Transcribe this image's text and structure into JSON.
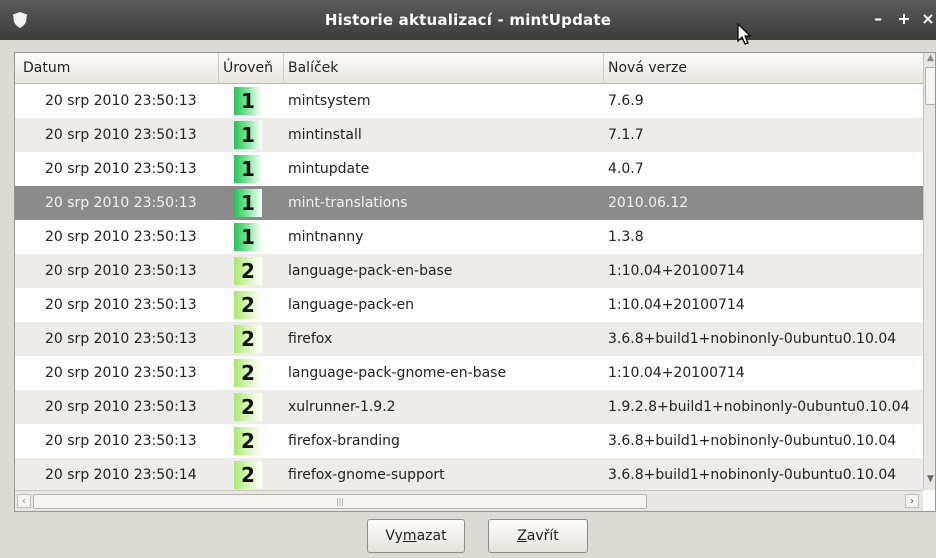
{
  "window": {
    "title": "Historie aktualizací - mintUpdate",
    "controls": {
      "minimize": "–",
      "maximize": "+",
      "close": "×"
    }
  },
  "table": {
    "columns": {
      "date": "Datum",
      "level": "Úroveň",
      "package": "Balíček",
      "new_version": "Nová verze"
    },
    "rows": [
      {
        "date": "20 srp 2010 23:50:13",
        "level": "1",
        "package": "mintsystem",
        "version": "7.6.9"
      },
      {
        "date": "20 srp 2010 23:50:13",
        "level": "1",
        "package": "mintinstall",
        "version": "7.1.7"
      },
      {
        "date": "20 srp 2010 23:50:13",
        "level": "1",
        "package": "mintupdate",
        "version": "4.0.7"
      },
      {
        "date": "20 srp 2010 23:50:13",
        "level": "1",
        "package": "mint-translations",
        "version": "2010.06.12",
        "selected": true
      },
      {
        "date": "20 srp 2010 23:50:13",
        "level": "1",
        "package": "mintnanny",
        "version": "1.3.8"
      },
      {
        "date": "20 srp 2010 23:50:13",
        "level": "2",
        "package": "language-pack-en-base",
        "version": "1:10.04+20100714"
      },
      {
        "date": "20 srp 2010 23:50:13",
        "level": "2",
        "package": "language-pack-en",
        "version": "1:10.04+20100714"
      },
      {
        "date": "20 srp 2010 23:50:13",
        "level": "2",
        "package": "firefox",
        "version": "3.6.8+build1+nobinonly-0ubuntu0.10.04"
      },
      {
        "date": "20 srp 2010 23:50:13",
        "level": "2",
        "package": "language-pack-gnome-en-base",
        "version": "1:10.04+20100714"
      },
      {
        "date": "20 srp 2010 23:50:13",
        "level": "2",
        "package": "xulrunner-1.9.2",
        "version": "1.9.2.8+build1+nobinonly-0ubuntu0.10.04"
      },
      {
        "date": "20 srp 2010 23:50:13",
        "level": "2",
        "package": "firefox-branding",
        "version": "3.6.8+build1+nobinonly-0ubuntu0.10.04"
      },
      {
        "date": "20 srp 2010 23:50:14",
        "level": "2",
        "package": "firefox-gnome-support",
        "version": "3.6.8+build1+nobinonly-0ubuntu0.10.04"
      }
    ]
  },
  "buttons": {
    "clear": {
      "before": "Vy",
      "mnemonic": "m",
      "after": "azat"
    },
    "close": {
      "before": "",
      "mnemonic": "Z",
      "after": "avřít"
    }
  },
  "colors": {
    "selected_row": "#8b8b8b",
    "level1": "#26c25a",
    "level2": "#a7e86f",
    "titlebar": "#3c3c3c"
  }
}
